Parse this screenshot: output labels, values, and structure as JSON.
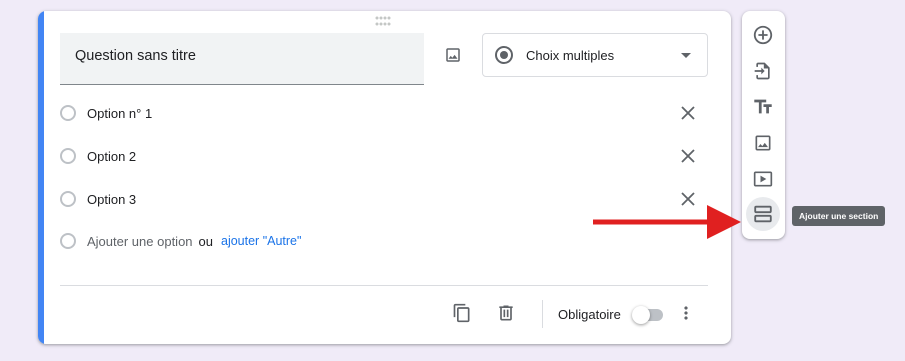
{
  "question": {
    "title": "Question sans titre",
    "type_label": "Choix multiples"
  },
  "options": [
    {
      "label": "Option n° 1"
    },
    {
      "label": "Option 2"
    },
    {
      "label": "Option 3"
    }
  ],
  "add_option": {
    "label": "Ajouter une option",
    "or": "ou",
    "other_link": "ajouter \"Autre\""
  },
  "footer": {
    "required_label": "Obligatoire",
    "required_on": false
  },
  "toolbar": {
    "items": [
      {
        "icon": "add-circle-icon"
      },
      {
        "icon": "import-questions-icon"
      },
      {
        "icon": "add-title-icon"
      },
      {
        "icon": "add-image-icon"
      },
      {
        "icon": "add-video-icon"
      },
      {
        "icon": "add-section-icon"
      }
    ],
    "tooltip": "Ajouter une section"
  },
  "colors": {
    "accent": "#4285f4",
    "background": "#f0ebf8",
    "link": "#1a73e8",
    "arrow": "#e02020"
  }
}
